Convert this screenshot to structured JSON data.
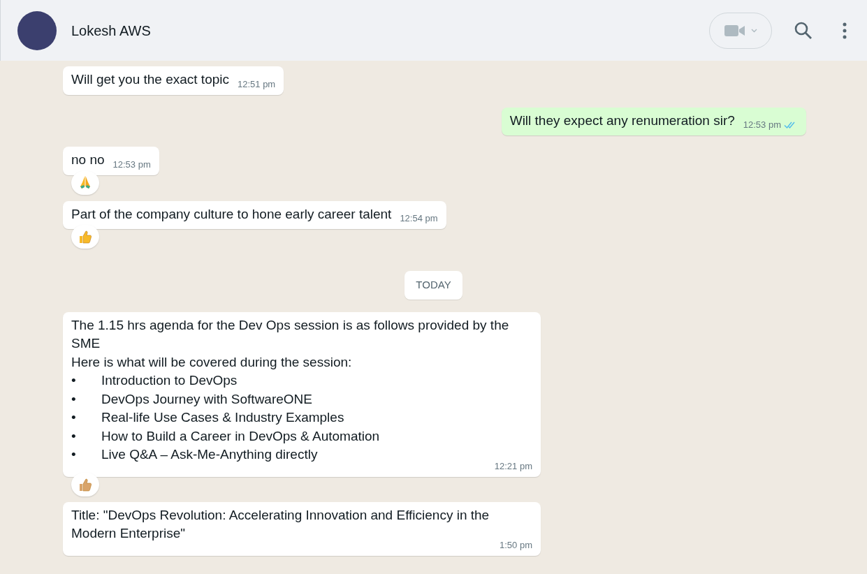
{
  "header": {
    "contact_name": "Lokesh AWS"
  },
  "messages": [
    {
      "kind": "incoming",
      "lines": [
        "Will get you the exact topic"
      ],
      "time": "12:51 pm"
    },
    {
      "kind": "outgoing",
      "lines": [
        "Will they expect any renumeration sir?"
      ],
      "time": "12:53 pm",
      "read": true
    },
    {
      "kind": "incoming",
      "lines": [
        "no no"
      ],
      "time": "12:53 pm",
      "reaction": {
        "kind": "pray"
      }
    },
    {
      "kind": "incoming",
      "lines": [
        "Part of the company culture to hone early career talent"
      ],
      "time": "12:54 pm",
      "reaction": {
        "kind": "thumbs_up"
      }
    },
    {
      "kind": "date",
      "label": "TODAY"
    },
    {
      "kind": "incoming",
      "lines": [
        "The 1.15 hrs agenda for the Dev Ops session is as follows provided by the SME",
        "Here is what will be covered during the session:"
      ],
      "bullets": [
        {
          "bullet": "•",
          "text": "Introduction to DevOps"
        },
        {
          "bullet": "•",
          "text": "DevOps Journey with SoftwareONE"
        },
        {
          "bullet": "•",
          "text": "Real-life Use Cases & Industry Examples"
        },
        {
          "bullet": "•",
          "text": "How to Build a Career in DevOps & Automation"
        },
        {
          "bullet": "•",
          "text": "Live Q&A – Ask-Me-Anything directly"
        }
      ],
      "time": "12:21 pm",
      "reaction": {
        "kind": "thumbs_up_tan"
      }
    },
    {
      "kind": "incoming",
      "lines": [
        "Title: \"DevOps Revolution: Accelerating Innovation and Efficiency in the Modern Enterprise\""
      ],
      "time": "1:50 pm"
    }
  ]
}
